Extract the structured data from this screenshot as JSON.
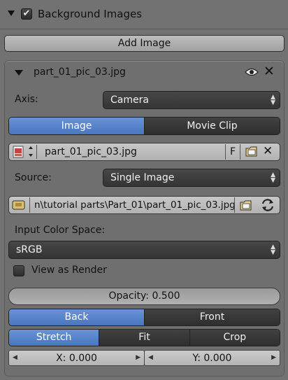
{
  "header": {
    "title": "Background Images",
    "enabled": true
  },
  "add_image_button": "Add Image",
  "image_entry": {
    "name": "part_01_pic_03.jpg",
    "axis_label": "Axis:",
    "axis_value": "Camera",
    "source_tabs": [
      {
        "label": "Image",
        "active": true
      },
      {
        "label": "Movie Clip",
        "active": false
      }
    ],
    "datablock_name": "part_01_pic_03.jpg",
    "fake_user_label": "F",
    "source_label": "Source:",
    "source_value": "Single Image",
    "filepath": "n\\tutorial parts\\Part_01\\part_01_pic_03.jpg",
    "color_space_label": "Input Color Space:",
    "color_space_value": "sRGB",
    "view_as_render_label": "View as Render",
    "view_as_render": false,
    "opacity_label": "Opacity:",
    "opacity_value": "0.500",
    "depth_tabs": [
      {
        "label": "Back",
        "active": true
      },
      {
        "label": "Front",
        "active": false
      }
    ],
    "frame_tabs": [
      {
        "label": "Stretch",
        "active": true
      },
      {
        "label": "Fit",
        "active": false
      },
      {
        "label": "Crop",
        "active": false
      }
    ],
    "offset_x": "X: 0.000",
    "offset_y": "Y: 0.000"
  }
}
